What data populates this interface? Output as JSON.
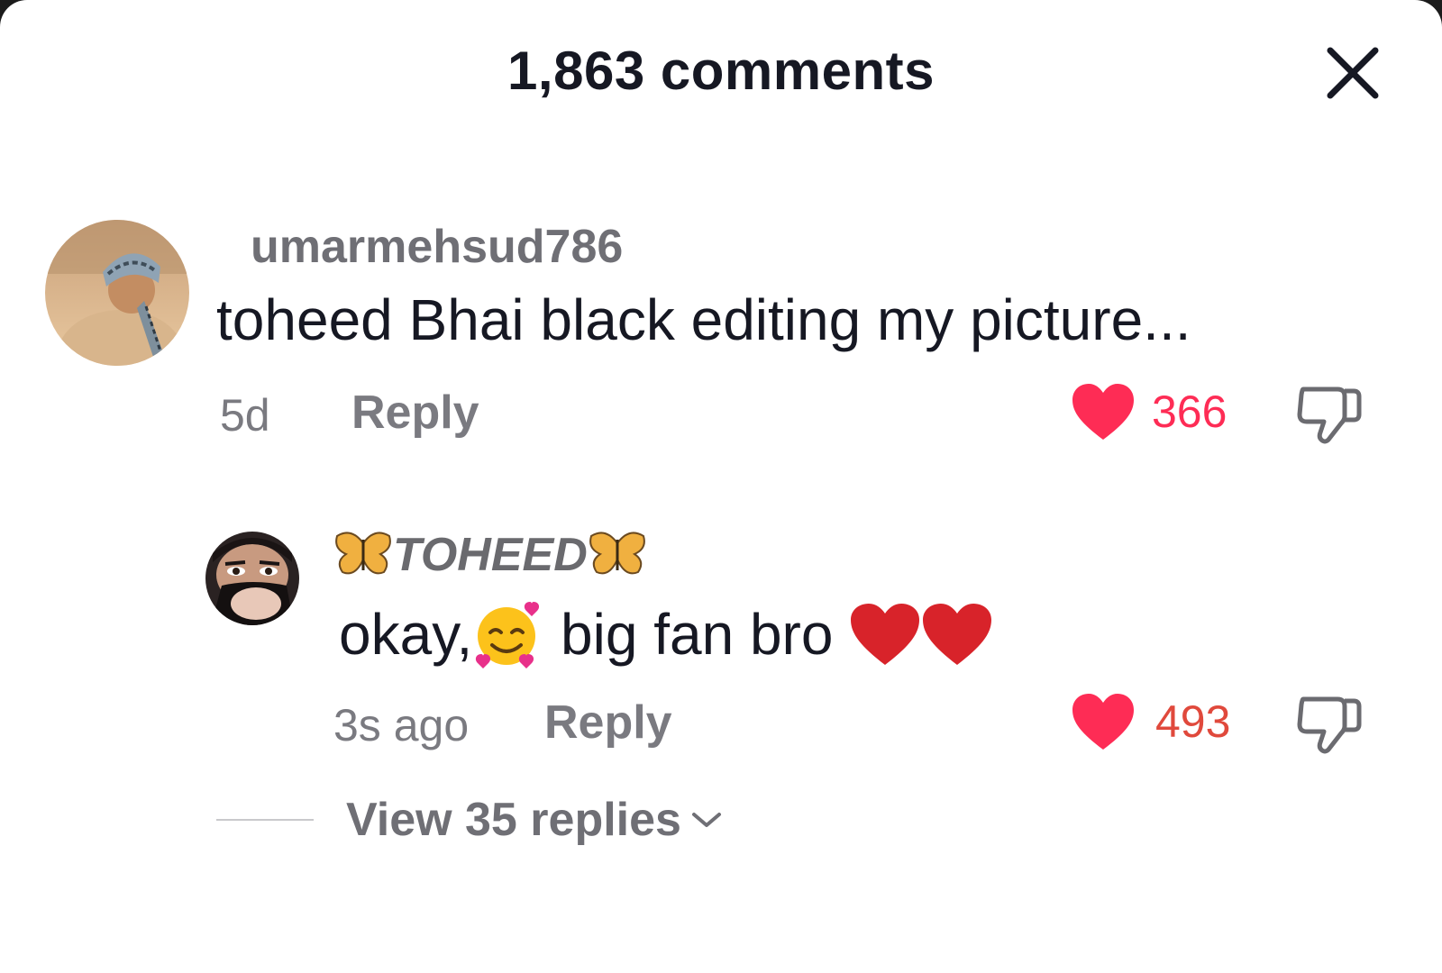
{
  "header": {
    "title": "1,863 comments",
    "close_icon": "close-icon"
  },
  "comments": [
    {
      "username": "umarmehsud786",
      "text": "toheed Bhai black editing my picture...",
      "time": "5d",
      "reply_label": "Reply",
      "likes": "366",
      "liked": true,
      "like_color": "#fe2c55",
      "avatar_icon": "avatar"
    },
    {
      "username_prefix_icon": "butterfly-icon",
      "username": "TOHEED",
      "username_suffix_icon": "butterfly-icon",
      "text_before_emoji": "okay,",
      "emoji_icon": "smiling-face-with-hearts-icon",
      "text_after_emoji": " big fan bro",
      "trailing_icons": [
        "red-heart-icon",
        "red-heart-icon"
      ],
      "time": "3s ago",
      "reply_label": "Reply",
      "likes": "493",
      "liked": true,
      "like_color": "#fe2c55",
      "count_color": "#e0493c",
      "avatar_icon": "avatar"
    }
  ],
  "view_replies": {
    "label": "View 35 replies",
    "chevron_icon": "chevron-down-icon"
  },
  "colors": {
    "accent_red": "#fe2c55",
    "text_primary": "#161823",
    "text_secondary": "#7a7a80"
  }
}
